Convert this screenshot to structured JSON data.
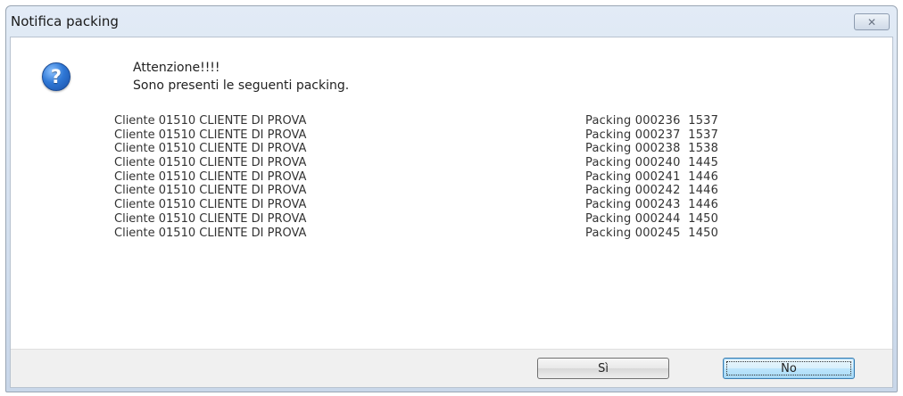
{
  "window": {
    "title": "Notifica packing",
    "close_glyph": "✕"
  },
  "message": {
    "icon": "question-icon",
    "icon_glyph": "?",
    "line1": "Attenzione!!!!",
    "line2": "Sono presenti le seguenti packing."
  },
  "rows": [
    {
      "client": "Cliente 01510 CLIENTE DI PROVA",
      "packing": "Packing 000236  1537"
    },
    {
      "client": "Cliente 01510 CLIENTE DI PROVA",
      "packing": "Packing 000237  1537"
    },
    {
      "client": "Cliente 01510 CLIENTE DI PROVA",
      "packing": "Packing 000238  1538"
    },
    {
      "client": "Cliente 01510 CLIENTE DI PROVA",
      "packing": "Packing 000240  1445"
    },
    {
      "client": "Cliente 01510 CLIENTE DI PROVA",
      "packing": "Packing 000241  1446"
    },
    {
      "client": "Cliente 01510 CLIENTE DI PROVA",
      "packing": "Packing 000242  1446"
    },
    {
      "client": "Cliente 01510 CLIENTE DI PROVA",
      "packing": "Packing 000243  1446"
    },
    {
      "client": "Cliente 01510 CLIENTE DI PROVA",
      "packing": "Packing 000244  1450"
    },
    {
      "client": "Cliente 01510 CLIENTE DI PROVA",
      "packing": "Packing 000245  1450"
    }
  ],
  "buttons": {
    "yes_label": "Sì",
    "no_label": "No"
  }
}
